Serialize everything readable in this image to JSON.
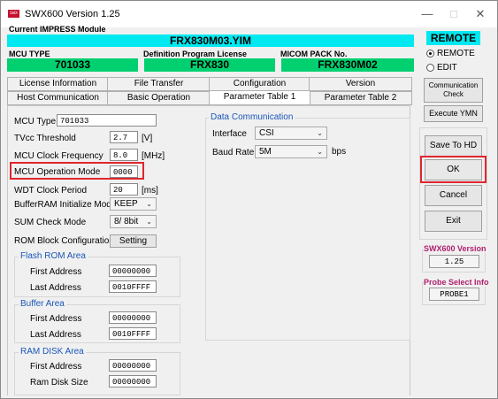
{
  "window": {
    "app_icon_text": "SWX",
    "title": "SWX600  Version  1.25"
  },
  "header": {
    "module_label": "Current IMPRESS Module",
    "module_value": "FRX830M03.YIM",
    "remote_label": "REMOTE",
    "mcu_type_label": "MCU TYPE",
    "mcu_type_value": "701033",
    "def_license_label": "Definition Program License",
    "def_license_value": "FRX830",
    "micom_pack_label": "MICOM PACK No.",
    "micom_pack_value": "FRX830M02"
  },
  "mode": {
    "remote_option": "REMOTE",
    "edit_option": "EDIT",
    "selected": "REMOTE"
  },
  "tabs": {
    "row1": [
      "License Information",
      "File Transfer",
      "Configuration",
      "Version"
    ],
    "row2": [
      "Host Communication",
      "Basic Operation",
      "Parameter Table 1",
      "Parameter Table 2"
    ],
    "active": "Parameter Table 1"
  },
  "params": {
    "mcu_type": {
      "label": "MCU Type",
      "value": "701033"
    },
    "tvcc": {
      "label": "TVcc Threshold",
      "value": "2.7",
      "unit": "[V]"
    },
    "mcu_clock": {
      "label": "MCU Clock Frequency",
      "value": "8.0",
      "unit": "[MHz]"
    },
    "mcu_op_mode": {
      "label": "MCU Operation Mode",
      "value": "0000"
    },
    "wdt": {
      "label": "WDT Clock Period",
      "value": "20",
      "unit": "[ms]"
    },
    "bufferram_init": {
      "label": "BufferRAM Initialize Mode",
      "value": "KEEP"
    },
    "sum_check": {
      "label": "SUM Check Mode",
      "value": "8/ 8bit"
    },
    "rom_block": {
      "label": "ROM Block Configuration",
      "button": "Setting"
    }
  },
  "flash_rom": {
    "title": "Flash ROM Area",
    "first_label": "First Address",
    "first_value": "00000000",
    "last_label": "Last Address",
    "last_value": "0010FFFF"
  },
  "buffer_area": {
    "title": "Buffer Area",
    "first_label": "First  Address",
    "first_value": "00000000",
    "last_label": "Last  Address",
    "last_value": "0010FFFF"
  },
  "ram_disk": {
    "title": "RAM DISK Area",
    "first_label": "First  Address",
    "first_value": "00000000",
    "size_label": "Ram Disk Size",
    "size_value": "00000000"
  },
  "data_comm": {
    "title": "Data Communication",
    "interface_label": "Interface",
    "interface_value": "CSI",
    "baud_label": "Baud Rate",
    "baud_value": "5M",
    "baud_unit": "bps"
  },
  "side": {
    "comm_check": [
      "Communication",
      "Check"
    ],
    "execute_ymn": "Execute YMN",
    "save_to_hd": "Save To HD",
    "ok": "OK",
    "cancel": "Cancel",
    "exit": "Exit",
    "version_label": "SWX600 Version",
    "version_value": "1.25",
    "probe_label": "Probe Select Info",
    "probe_value": "PROBE1"
  },
  "colors": {
    "cyan": "#00e8f0",
    "green": "#00d070",
    "highlight_red": "#e0262e",
    "group_title_blue": "#1a56b8",
    "info_pink": "#b0206e"
  }
}
